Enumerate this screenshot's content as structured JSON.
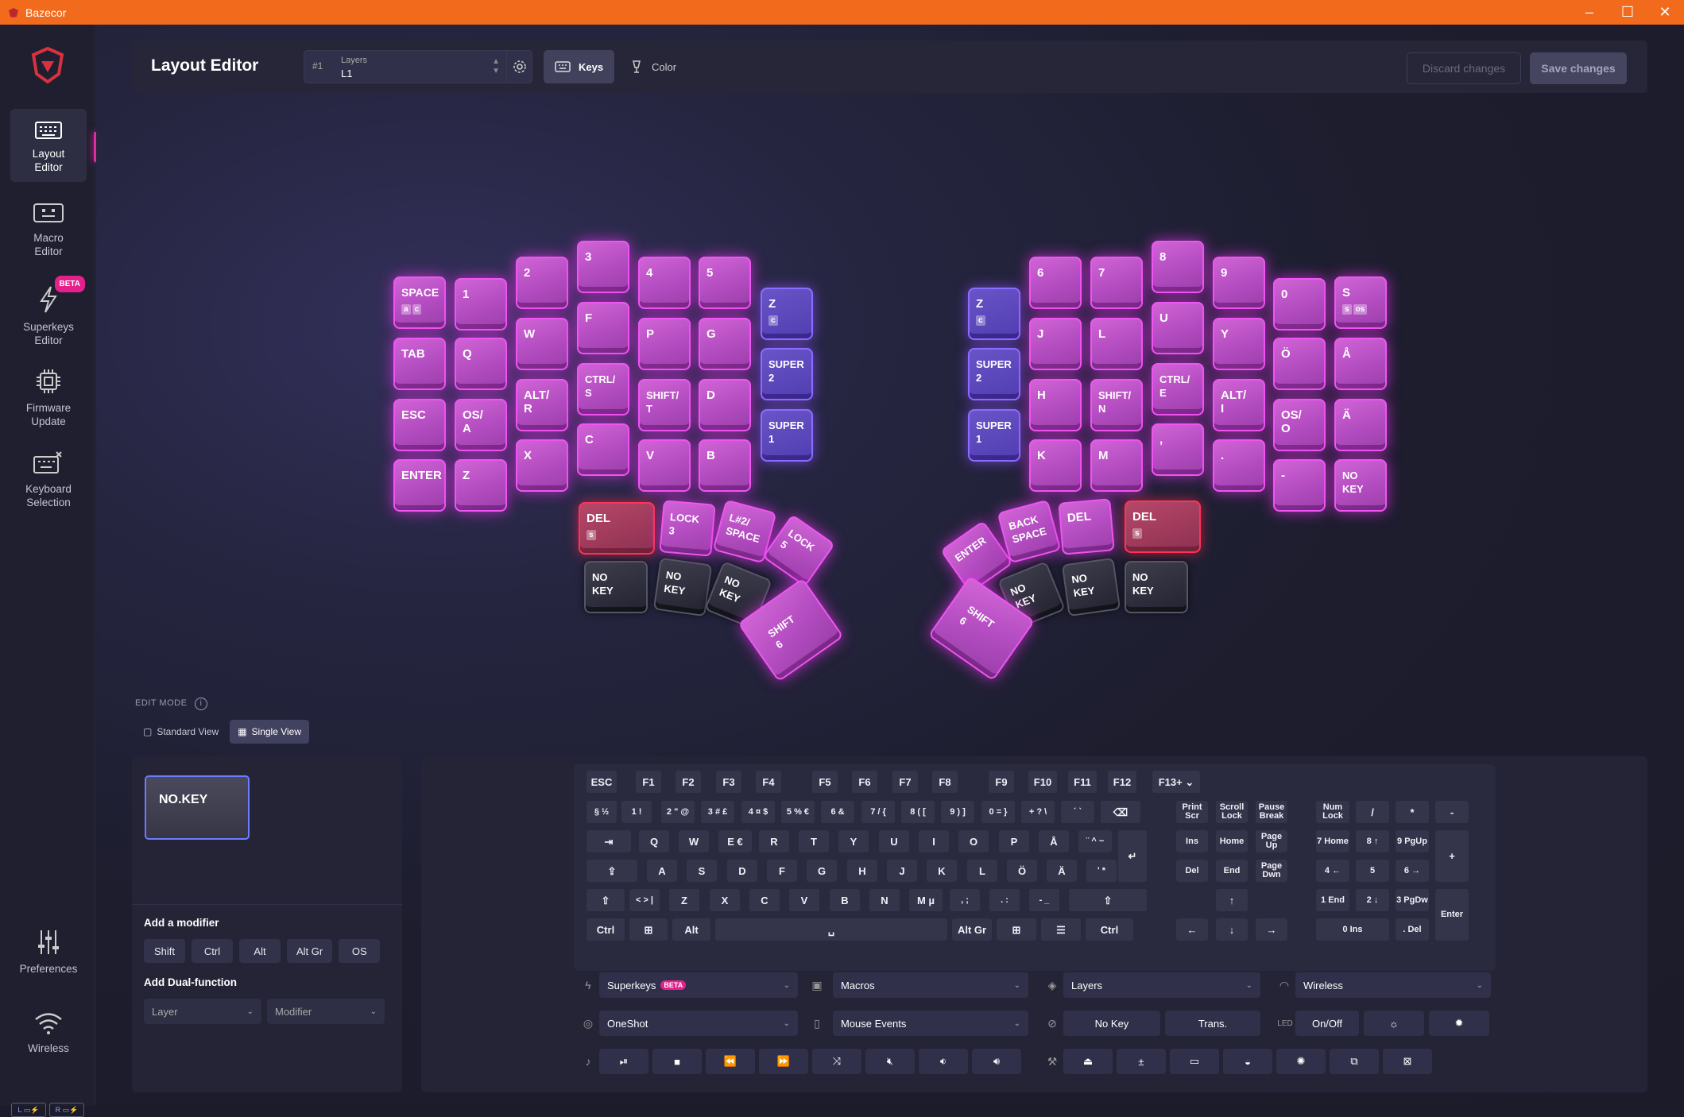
{
  "window": {
    "title": "Bazecor"
  },
  "sidebar": {
    "items": [
      {
        "label": "Layout\nEditor",
        "line1": "Layout",
        "line2": "Editor"
      },
      {
        "line1": "Macro",
        "line2": "Editor"
      },
      {
        "line1": "Superkeys",
        "line2": "Editor",
        "badge": "BETA"
      },
      {
        "line1": "Firmware",
        "line2": "Update"
      },
      {
        "line1": "Keyboard",
        "line2": "Selection"
      },
      {
        "line1": "Preferences"
      },
      {
        "line1": "Wireless"
      }
    ],
    "battery_left": "L",
    "battery_right": "R"
  },
  "header": {
    "title": "Layout Editor",
    "layer_num": "#1",
    "layer_label": "Layers",
    "layer_value": "L1",
    "keys_tab": "Keys",
    "color_tab": "Color",
    "discard": "Discard changes",
    "save": "Save changes"
  },
  "left_half": {
    "keys": [
      "SPACE",
      "1",
      "2",
      "3",
      "4",
      "5",
      "Z",
      "TAB",
      "Q",
      "W",
      "F",
      "P",
      "G",
      "SUPER\n2",
      "ESC",
      "OS/\nA",
      "ALT/\nR",
      "CTRL/\nS",
      "SHIFT/\nT",
      "D",
      "SUPER\n1",
      "ENTER",
      "Z",
      "X",
      "C",
      "V",
      "B"
    ],
    "space_subs": [
      "a",
      "c"
    ],
    "z_sub": "c",
    "thumb": [
      "DEL",
      "LOCK\n3",
      "L#2/\nSPACE",
      "LOCK\n5",
      "NO\nKEY",
      "NO\nKEY",
      "NO\nKEY",
      "SHIFT\n6"
    ],
    "del_sub": "s"
  },
  "right_half": {
    "keys": [
      "6",
      "7",
      "8",
      "9",
      "0",
      "S",
      "Z",
      "J",
      "L",
      "U",
      "Y",
      "Ö",
      "Å",
      "SUPER\n2",
      "H",
      "SHIFT/\nN",
      "CTRL/\nE",
      "ALT/\nI",
      "OS/\nO",
      "Ä",
      "SUPER\n1",
      "K",
      "M",
      ",",
      ".",
      "-",
      "NO\nKEY"
    ],
    "s_subs": [
      "s",
      "os"
    ],
    "z_sub": "c",
    "thumb": [
      "ENTER",
      "BACK\nSPACE",
      "DEL",
      "DEL",
      "NO\nKEY",
      "NO\nKEY",
      "NO\nKEY",
      "SHIFT\n6"
    ],
    "del_sub": "s"
  },
  "edit_mode": {
    "label": "EDIT MODE",
    "standard": "Standard View",
    "single": "Single View"
  },
  "left_panel": {
    "key_name": "NO.KEY",
    "add_modifier": "Add a modifier",
    "modifiers": [
      "Shift",
      "Ctrl",
      "Alt",
      "Alt Gr",
      "OS"
    ],
    "add_dual": "Add Dual-function",
    "layer_sel": "Layer",
    "modifier_sel": "Modifier"
  },
  "virtual_keyboard": {
    "frow": [
      "ESC",
      "F1",
      "F2",
      "F3",
      "F4",
      "F5",
      "F6",
      "F7",
      "F8",
      "F9",
      "F10",
      "F11",
      "F12",
      "F13+"
    ],
    "row1": [
      "§ ½",
      "1 !",
      "2 \" @",
      "3 # £",
      "4 ¤ $",
      "5 % €",
      "6 &",
      "7 / {",
      "8 ( [",
      "9 ) ]",
      "0 = }",
      "+ ? \\",
      "´ `",
      "⌫"
    ],
    "row2": [
      "⇥",
      "Q",
      "W",
      "E €",
      "R",
      "T",
      "Y",
      "U",
      "I",
      "O",
      "P",
      "Å",
      "¨ ^ ~",
      "↵"
    ],
    "row3": [
      "⇪",
      "A",
      "S",
      "D",
      "F",
      "G",
      "H",
      "J",
      "K",
      "L",
      "Ö",
      "Ä",
      "' *"
    ],
    "row4": [
      "⇧",
      "< > |",
      "Z",
      "X",
      "C",
      "V",
      "B",
      "N",
      "M µ",
      ", ;",
      ". :",
      "- _",
      "⇧"
    ],
    "row5": [
      "Ctrl",
      "⊞",
      "Alt",
      "␣",
      "Alt Gr",
      "⊞",
      "☰",
      "Ctrl"
    ],
    "nav": [
      "Print Scr",
      "Scroll Lock",
      "Pause Break",
      "Ins",
      "Home",
      "Page Up",
      "Del",
      "End",
      "Page Dwn",
      "↑",
      "←",
      "↓",
      "→"
    ],
    "numpad": [
      "Num Lock",
      "/",
      "*",
      "-",
      "7 Home",
      "8 ↑",
      "9 PgUp",
      "+",
      "4 ←",
      "5",
      "6 →",
      "1 End",
      "2 ↓",
      "3 PgDw",
      "Enter",
      "0 Ins",
      ". Del"
    ]
  },
  "controls": {
    "superkeys": "Superkeys",
    "beta": "BETA",
    "macros": "Macros",
    "layers": "Layers",
    "wireless": "Wireless",
    "oneshot": "OneShot",
    "mouse": "Mouse Events",
    "nokey": "No Key",
    "trans": "Trans.",
    "led": "LED",
    "onoff": "On/Off"
  }
}
